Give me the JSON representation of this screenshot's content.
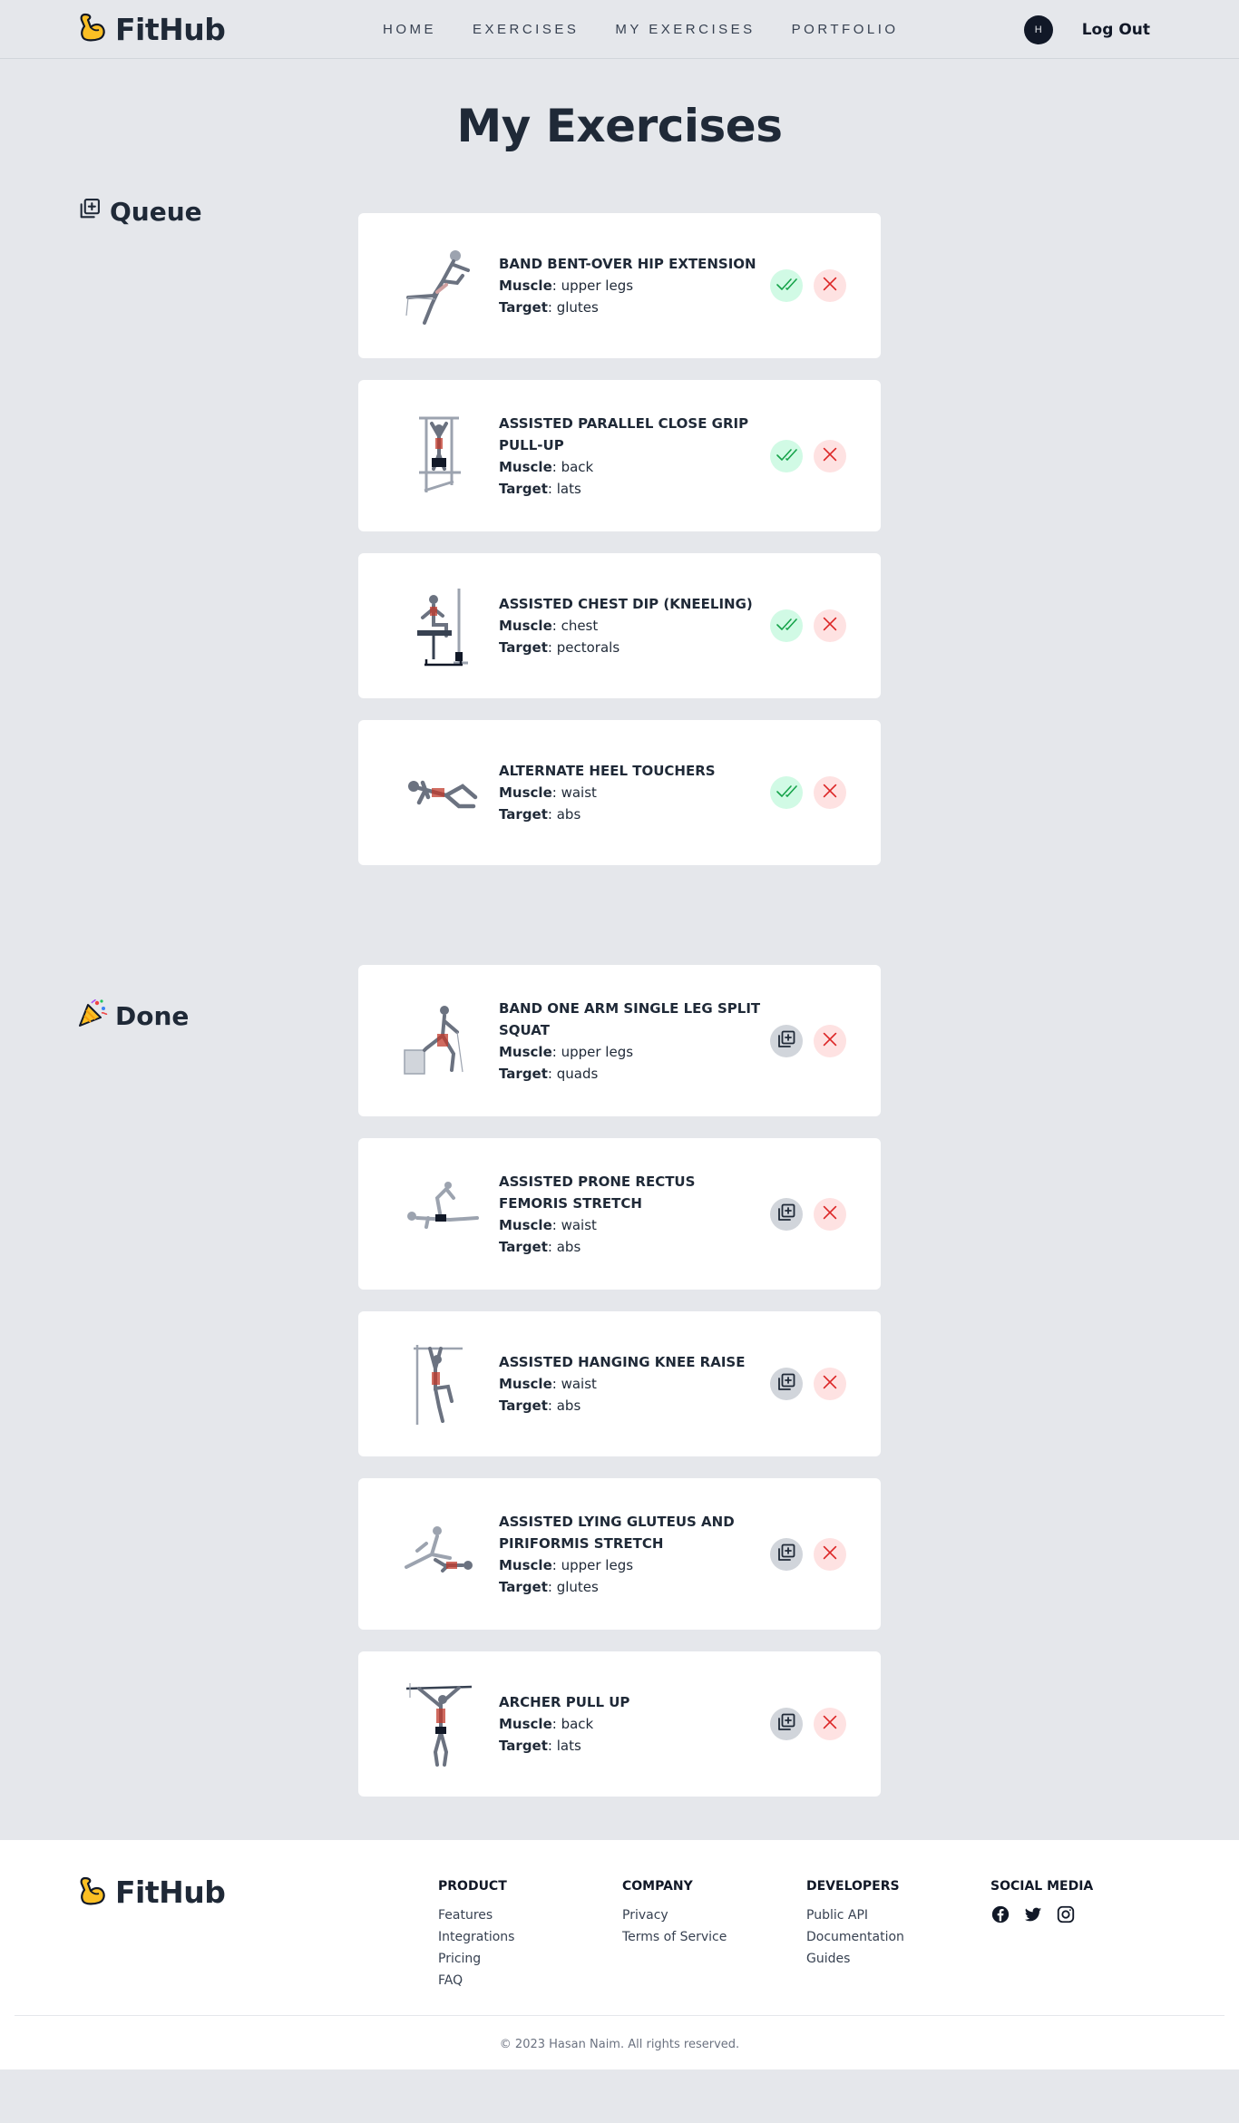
{
  "brand": {
    "name": "FitHub"
  },
  "nav": {
    "items": [
      "HOME",
      "EXERCISES",
      "MY EXERCISES",
      "PORTFOLIO"
    ]
  },
  "account": {
    "avatar_initial": "H",
    "logout_label": "Log Out"
  },
  "page": {
    "title": "My Exercises"
  },
  "labels": {
    "muscle": "Muscle",
    "target": "Target"
  },
  "queue": {
    "heading": "Queue",
    "exercises": [
      {
        "name": "BAND BENT-OVER HIP EXTENSION",
        "muscle": "upper legs",
        "target": "glutes"
      },
      {
        "name": "ASSISTED PARALLEL CLOSE GRIP PULL-UP",
        "muscle": "back",
        "target": "lats"
      },
      {
        "name": "ASSISTED CHEST DIP (KNEELING)",
        "muscle": "chest",
        "target": "pectorals"
      },
      {
        "name": "ALTERNATE HEEL TOUCHERS",
        "muscle": "waist",
        "target": "abs"
      }
    ]
  },
  "done": {
    "heading": "Done",
    "exercises": [
      {
        "name": "BAND ONE ARM SINGLE LEG SPLIT SQUAT",
        "muscle": "upper legs",
        "target": "quads"
      },
      {
        "name": "ASSISTED PRONE RECTUS FEMORIS STRETCH",
        "muscle": "waist",
        "target": "abs"
      },
      {
        "name": "ASSISTED HANGING KNEE RAISE",
        "muscle": "waist",
        "target": "abs"
      },
      {
        "name": "ASSISTED LYING GLUTEUS AND PIRIFORMIS STRETCH",
        "muscle": "upper legs",
        "target": "glutes"
      },
      {
        "name": "ARCHER PULL UP",
        "muscle": "back",
        "target": "lats"
      }
    ]
  },
  "footer": {
    "columns": [
      {
        "title": "PRODUCT",
        "links": [
          "Features",
          "Integrations",
          "Pricing",
          "FAQ"
        ]
      },
      {
        "title": "COMPANY",
        "links": [
          "Privacy",
          "Terms of Service"
        ]
      },
      {
        "title": "DEVELOPERS",
        "links": [
          "Public API",
          "Documentation",
          "Guides"
        ]
      }
    ],
    "social_title": "SOCIAL MEDIA",
    "social_icons": [
      "facebook-icon",
      "twitter-icon",
      "instagram-icon"
    ],
    "copyright": "© 2023 Hasan Naim. All rights reserved."
  },
  "colors": {
    "background": "#e5e7eb",
    "card": "#ffffff",
    "brand_yellow": "#fbbf24",
    "done_bg": "#d1fae5",
    "done_fg": "#16a34a",
    "remove_bg": "#fee2e2",
    "remove_fg": "#dc2626"
  }
}
